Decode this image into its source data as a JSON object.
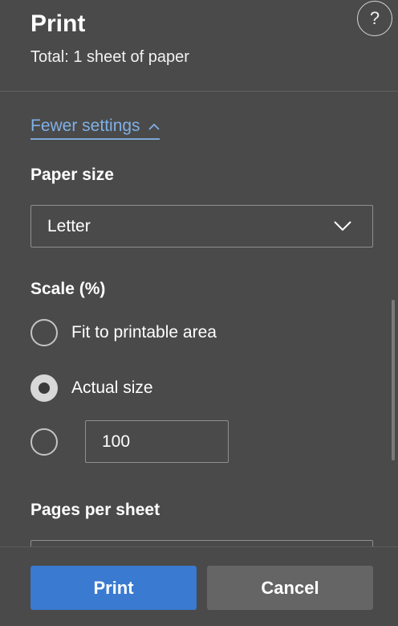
{
  "header": {
    "title": "Print",
    "subtitle": "Total: 1 sheet of paper",
    "help_glyph": "?"
  },
  "settings": {
    "fewer_label": "Fewer settings",
    "paper_size": {
      "label": "Paper size",
      "value": "Letter"
    },
    "scale": {
      "label": "Scale (%)",
      "options": [
        {
          "label": "Fit to printable area",
          "checked": false
        },
        {
          "label": "Actual size",
          "checked": true
        },
        {
          "label": "",
          "checked": false
        }
      ],
      "custom_value": "100"
    },
    "pages_per_sheet": {
      "label": "Pages per sheet"
    }
  },
  "footer": {
    "print_label": "Print",
    "cancel_label": "Cancel"
  },
  "colors": {
    "background": "#4a4a4a",
    "accent": "#3a7ad0",
    "link": "#7fb0e6",
    "secondary_button": "#656565"
  },
  "icons": [
    "help-icon",
    "chevron-up-icon",
    "chevron-down-icon"
  ]
}
